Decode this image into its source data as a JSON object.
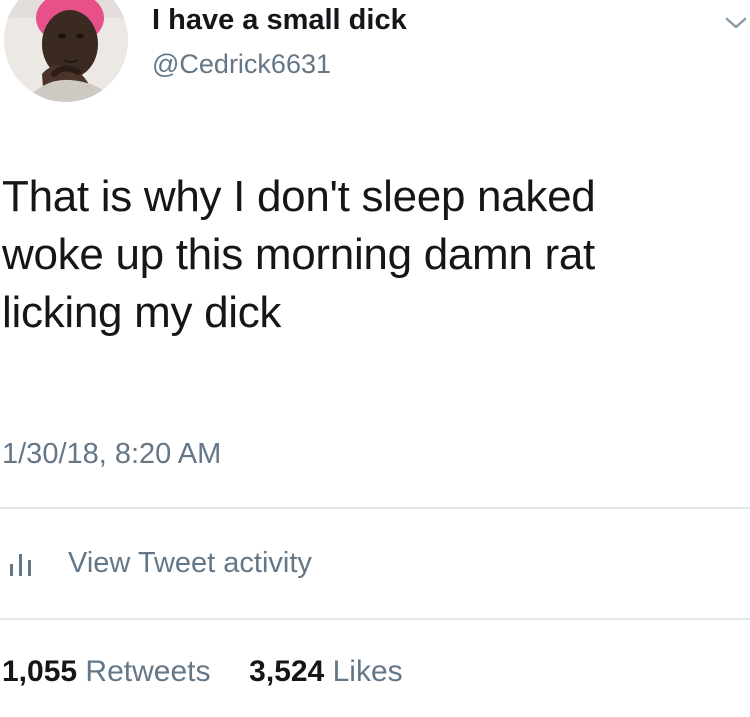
{
  "tweet": {
    "author": {
      "display_name": "I have a small dick",
      "handle": "@Cedrick6631",
      "avatar_icon": "profile-photo"
    },
    "text_lines": [
      "That is why I don't sleep naked",
      "woke up this morning damn rat",
      "licking my dick"
    ],
    "timestamp": "1/30/18, 8:20 AM",
    "activity": {
      "icon": "bar-chart-icon",
      "label": "View Tweet activity"
    },
    "stats": {
      "retweets_count": "1,055",
      "retweets_label": "Retweets",
      "likes_count": "3,524",
      "likes_label": "Likes"
    },
    "menu_icon": "chevron-down-icon"
  },
  "colors": {
    "primary_text": "#14171a",
    "secondary_text": "#657786",
    "divider": "#e1e8ed",
    "background": "#ffffff"
  }
}
